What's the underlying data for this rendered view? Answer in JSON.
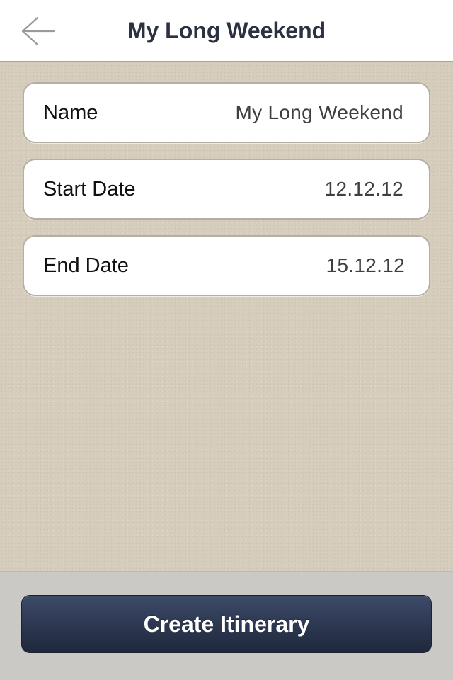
{
  "nav": {
    "title": "My Long Weekend",
    "back_icon": "arrow-left-icon"
  },
  "form": {
    "fields": [
      {
        "label": "Name",
        "value": "My Long Weekend"
      },
      {
        "label": "Start Date",
        "value": "12.12.12"
      },
      {
        "label": "End Date",
        "value": "15.12.12"
      }
    ]
  },
  "toolbar": {
    "create_label": "Create Itinerary"
  },
  "colors": {
    "nav_background": "#ffffff",
    "title_text": "#2b3140",
    "page_background": "#d6cdbd",
    "button_background": "#2c3750",
    "button_text": "#ffffff"
  }
}
